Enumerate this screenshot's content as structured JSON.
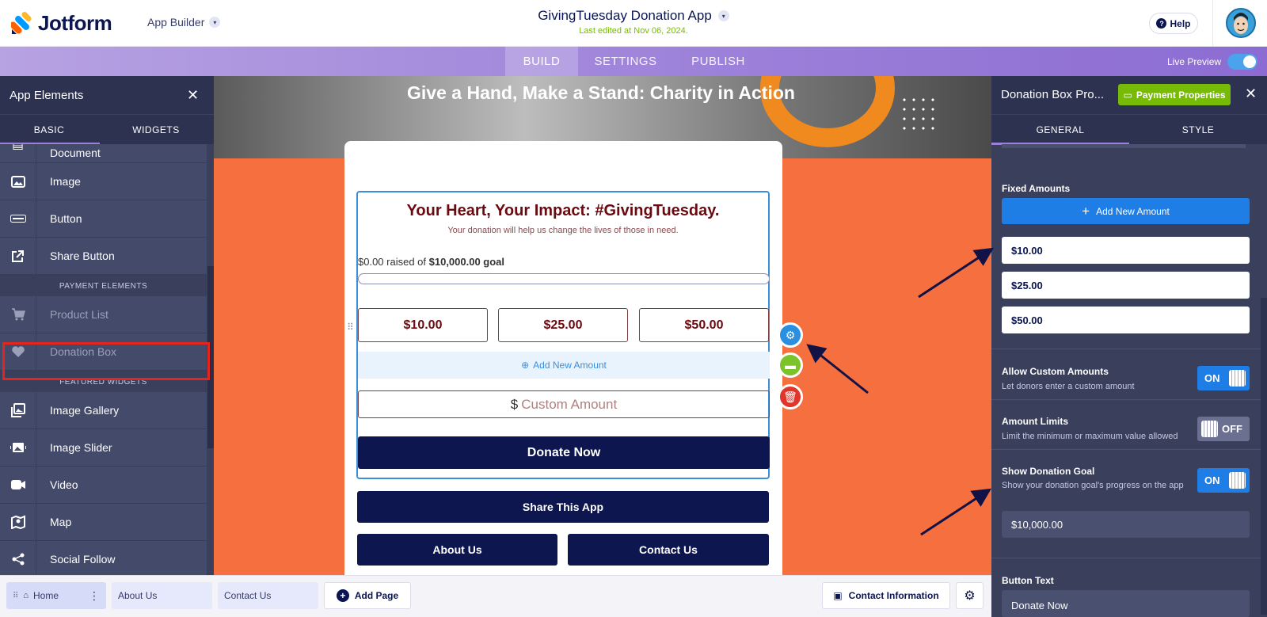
{
  "header": {
    "logo_text": "Jotform",
    "app_builder_label": "App Builder",
    "app_title": "GivingTuesday Donation App",
    "last_edited": "Last edited at Nov 06, 2024.",
    "help_label": "Help"
  },
  "nav": {
    "tabs": [
      "BUILD",
      "SETTINGS",
      "PUBLISH"
    ],
    "active_tab": "BUILD",
    "live_preview_label": "Live Preview",
    "live_preview_on": true
  },
  "left_panel": {
    "title": "App Elements",
    "tabs": [
      "BASIC",
      "WIDGETS"
    ],
    "active_tab": "BASIC",
    "items": [
      {
        "label": "Document",
        "icon": "document-icon"
      },
      {
        "label": "Image",
        "icon": "image-icon"
      },
      {
        "label": "Button",
        "icon": "button-icon"
      },
      {
        "label": "Share Button",
        "icon": "share-icon"
      }
    ],
    "payment_section": "PAYMENT ELEMENTS",
    "payment_items": [
      {
        "label": "Product List",
        "icon": "cart-icon"
      },
      {
        "label": "Donation Box",
        "icon": "heart-icon"
      }
    ],
    "featured_section": "FEATURED WIDGETS",
    "featured_items": [
      {
        "label": "Image Gallery",
        "icon": "gallery-icon"
      },
      {
        "label": "Image Slider",
        "icon": "slider-icon"
      },
      {
        "label": "Video",
        "icon": "video-icon"
      },
      {
        "label": "Map",
        "icon": "map-icon"
      },
      {
        "label": "Social Follow",
        "icon": "social-icon"
      }
    ]
  },
  "canvas": {
    "banner_title": "Give a Hand, Make a Stand: Charity in Action",
    "donation": {
      "heading": "Your Heart, Your Impact: #GivingTuesday.",
      "subheading": "Your donation will help us change the lives of those in need.",
      "raised_prefix": "$0.00 raised of ",
      "goal_text": "$10,000.00 goal",
      "progress": 0,
      "amounts": [
        "$10.00",
        "$25.00",
        "$50.00"
      ],
      "add_amount_label": "Add New Amount",
      "currency_symbol": "$",
      "custom_placeholder": "Custom Amount",
      "donate_label": "Donate Now"
    },
    "share_label": "Share This App",
    "about_label": "About Us",
    "contact_label": "Contact Us"
  },
  "right_panel": {
    "title": "Donation Box Pro...",
    "payment_properties_label": "Payment Properties",
    "tabs": [
      "GENERAL",
      "STYLE"
    ],
    "active_tab": "GENERAL",
    "fixed_amounts_label": "Fixed Amounts",
    "add_new_amount_label": "Add New Amount",
    "fixed_amounts": [
      "$10.00",
      "$25.00",
      "$50.00"
    ],
    "allow_custom": {
      "label": "Allow Custom Amounts",
      "desc": "Let donors enter a custom amount",
      "state": "ON"
    },
    "amount_limits": {
      "label": "Amount Limits",
      "desc": "Limit the minimum or maximum value allowed",
      "state": "OFF"
    },
    "show_goal": {
      "label": "Show Donation Goal",
      "desc": "Show your donation goal's progress on the app",
      "state": "ON"
    },
    "goal_value": "$10,000.00",
    "button_text_label": "Button Text",
    "button_text_value": "Donate Now"
  },
  "bottom_bar": {
    "pages": [
      "Home",
      "About Us",
      "Contact Us"
    ],
    "add_page_label": "Add Page",
    "contact_info_label": "Contact Information"
  },
  "colors": {
    "brand_navy": "#0a1551",
    "canvas_orange": "#f66f3e",
    "accent_purple": "#9b7fd9",
    "toggle_blue": "#1f7ee6",
    "highlight_red": "#e3251e"
  }
}
